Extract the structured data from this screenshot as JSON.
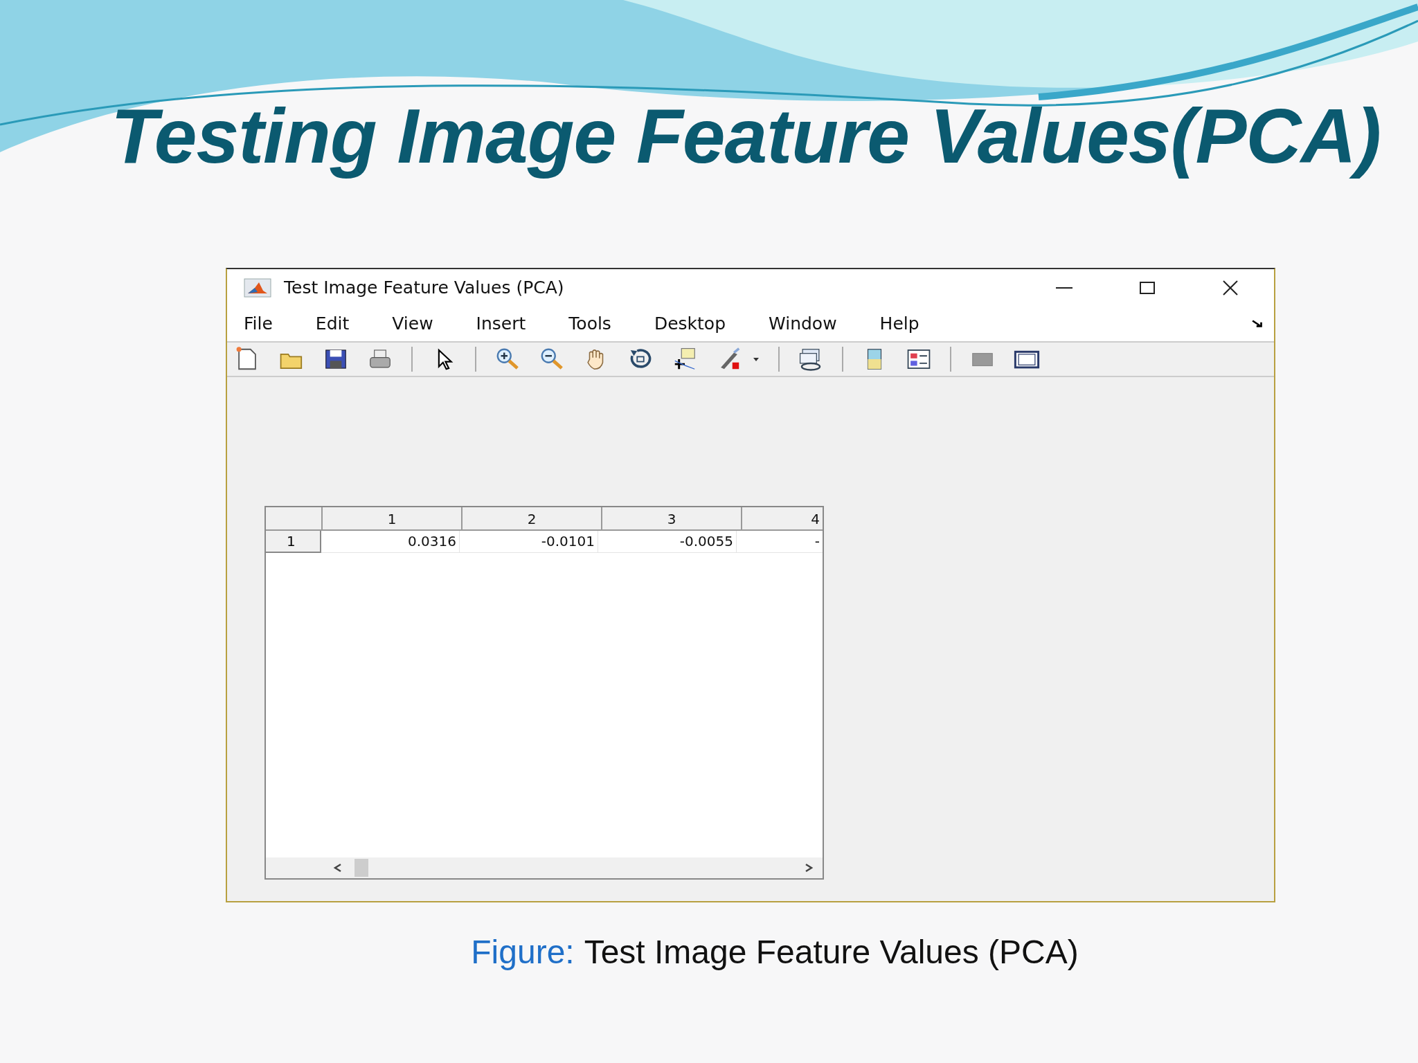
{
  "slide": {
    "title": "Testing Image Feature Values(PCA)"
  },
  "window": {
    "title": "Test Image Feature Values (PCA)"
  },
  "menu": [
    "File",
    "Edit",
    "View",
    "Insert",
    "Tools",
    "Desktop",
    "Window",
    "Help"
  ],
  "table": {
    "columns": [
      "1",
      "2",
      "3",
      "4"
    ],
    "rows": [
      {
        "header": "1",
        "cells": [
          "0.0316",
          "-0.0101",
          "-0.0055",
          "-"
        ]
      }
    ]
  },
  "caption": {
    "label": "Figure:",
    "text": "Test Image Feature Values (PCA)"
  }
}
